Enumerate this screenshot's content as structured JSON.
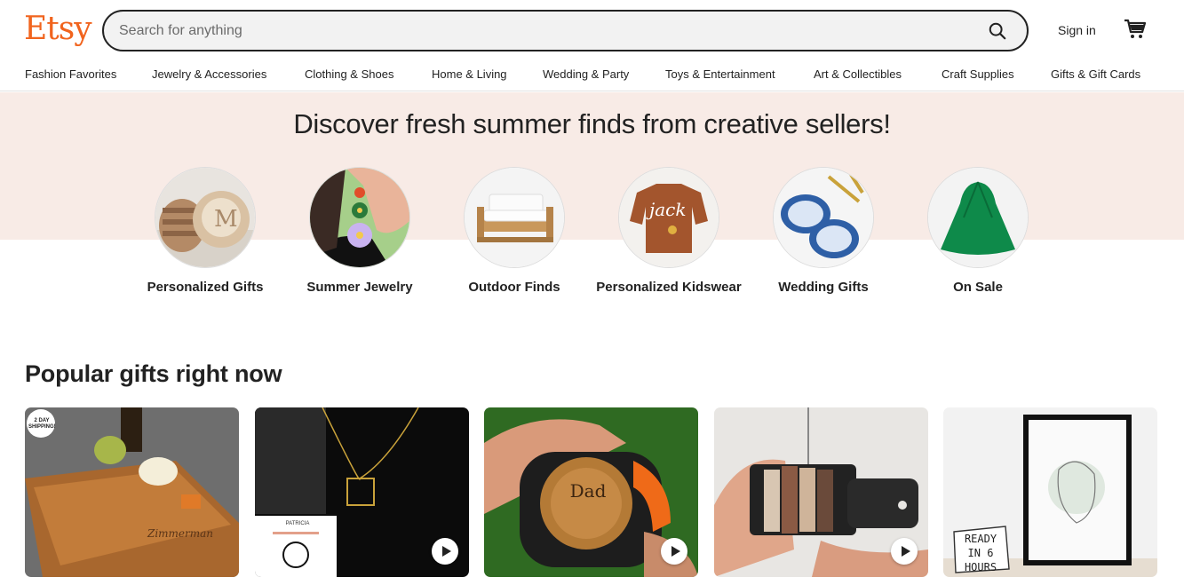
{
  "header": {
    "logo": "Etsy",
    "search_placeholder": "Search for anything",
    "signin": "Sign in"
  },
  "nav": {
    "items": [
      "Fashion Favorites",
      "Jewelry & Accessories",
      "Clothing & Shoes",
      "Home & Living",
      "Wedding & Party",
      "Toys & Entertainment",
      "Art & Collectibles",
      "Craft Supplies",
      "Gifts & Gift Cards"
    ]
  },
  "banner": {
    "title": "Discover fresh summer finds from creative sellers!",
    "circles": [
      {
        "label": "Personalized Gifts"
      },
      {
        "label": "Summer Jewelry"
      },
      {
        "label": "Outdoor Finds"
      },
      {
        "label": "Personalized Kidswear"
      },
      {
        "label": "Wedding Gifts"
      },
      {
        "label": "On Sale"
      }
    ]
  },
  "popular": {
    "title": "Popular gifts right now",
    "cards": [
      {
        "badge": "2 DAY SHIPPING!",
        "has_video": false
      },
      {
        "overlay_text": "PATRICIA",
        "has_video": true
      },
      {
        "engraving": "Dad",
        "has_video": true
      },
      {
        "has_video": true
      },
      {
        "sticker": "READY IN 6 HOURS",
        "has_video": false
      }
    ]
  },
  "colors": {
    "brand": "#F1641E",
    "banner_bg": "#F8EBE6"
  }
}
